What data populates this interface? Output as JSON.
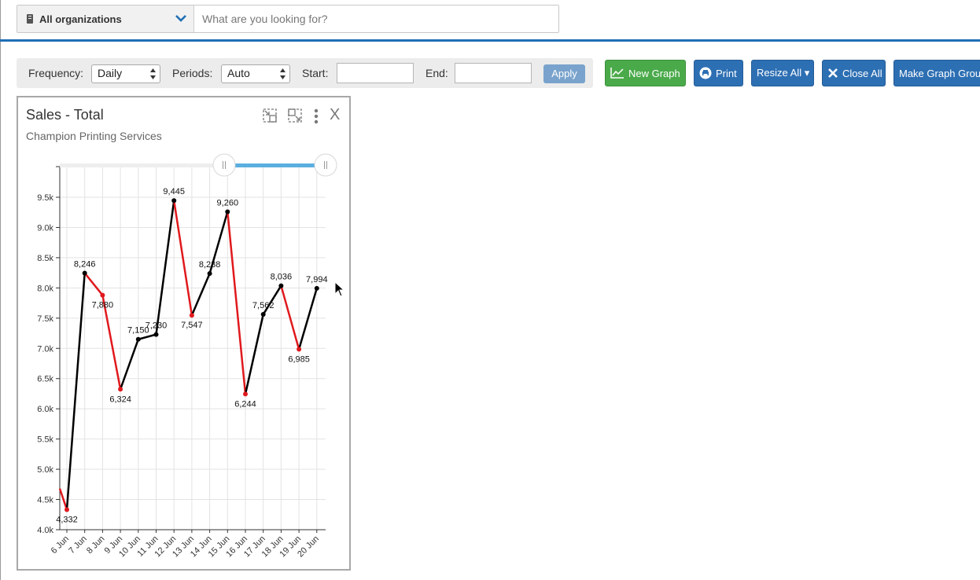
{
  "header": {
    "org_selector": "All organizations",
    "search_placeholder": "What are you looking for?"
  },
  "filters": {
    "frequency_label": "Frequency:",
    "frequency_value": "Daily",
    "periods_label": "Periods:",
    "periods_value": "Auto",
    "start_label": "Start:",
    "start_value": "",
    "end_label": "End:",
    "end_value": "",
    "apply_label": "Apply"
  },
  "toolbar": {
    "new_graph": "New Graph",
    "print": "Print",
    "resize_all": "Resize All ▾",
    "close_all": "Close All",
    "make_group": "Make Graph Group"
  },
  "graph": {
    "title": "Sales - Total",
    "subtitle": "Champion Printing Services",
    "close_label": "X"
  },
  "chart_data": {
    "type": "line",
    "categories": [
      "6 Jun",
      "7 Jun",
      "8 Jun",
      "9 Jun",
      "10 Jun",
      "11 Jun",
      "12 Jun",
      "13 Jun",
      "14 Jun",
      "15 Jun",
      "16 Jun",
      "17 Jun",
      "18 Jun",
      "19 Jun",
      "20 Jun"
    ],
    "values": [
      4332,
      8246,
      7880,
      6324,
      7150,
      7230,
      9445,
      7547,
      8238,
      9260,
      6244,
      7562,
      8036,
      6985,
      7994
    ],
    "labels": [
      "4,332",
      "8,246",
      "7,880",
      "6,324",
      "7,150",
      "7,230",
      "9,445",
      "7,547",
      "8,238",
      "9,260",
      "6,244",
      "7,562",
      "8,036",
      "6,985",
      "7,994"
    ],
    "ylim": [
      4000,
      10000
    ],
    "yticks": [
      "4.0k",
      "4.5k",
      "5.0k",
      "5.5k",
      "6.0k",
      "6.5k",
      "7.0k",
      "7.5k",
      "8.0k",
      "8.5k",
      "9.0k",
      "9.5k"
    ],
    "up_color": "#000000",
    "down_color": "#e0191d",
    "range_slider_color": "#5aaee0",
    "grid": true
  }
}
